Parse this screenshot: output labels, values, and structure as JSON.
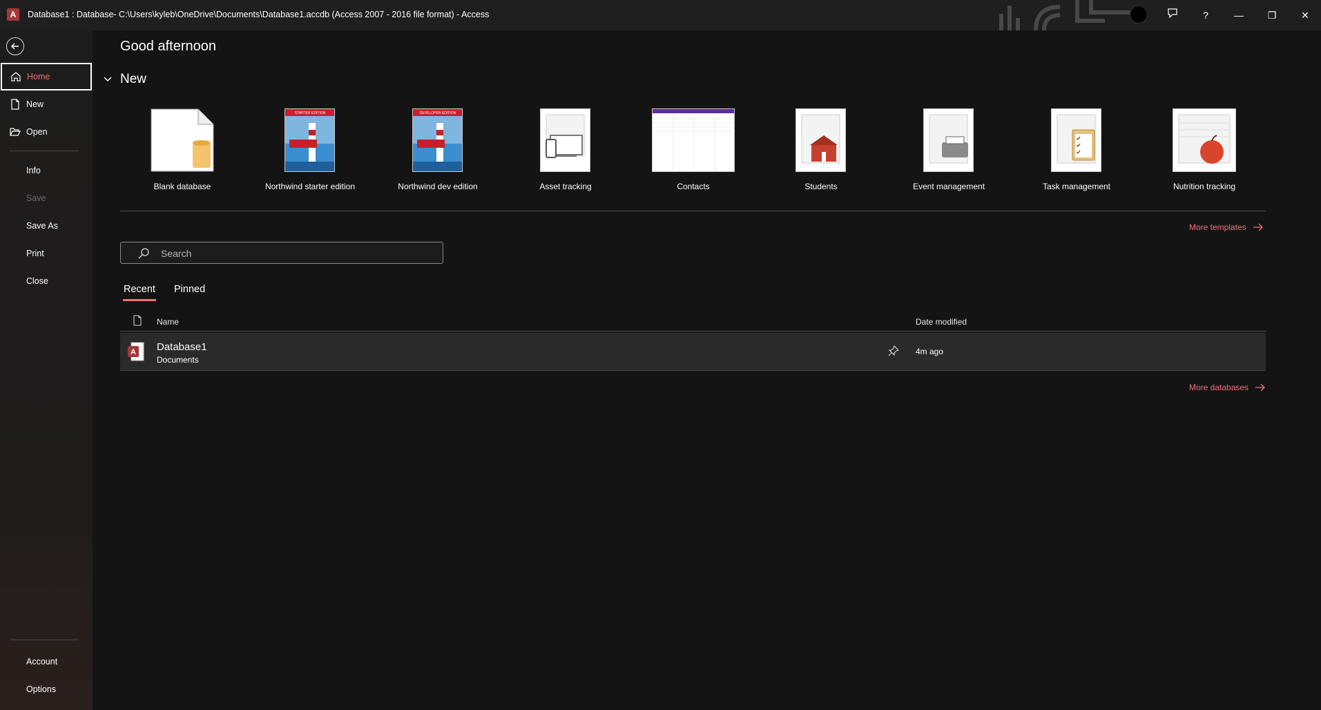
{
  "window": {
    "title": "Database1 : Database- C:\\Users\\kyleb\\OneDrive\\Documents\\Database1.accdb (Access 2007 - 2016 file format)  -  Access",
    "app_icon_letter": "A",
    "buttons": {
      "feedback": "feedback-icon",
      "help": "?",
      "minimize": "—",
      "restore": "❐",
      "close": "✕"
    }
  },
  "sidebar": {
    "items": [
      {
        "label": "Home",
        "icon": "home-icon"
      },
      {
        "label": "New",
        "icon": "new-document-icon"
      },
      {
        "label": "Open",
        "icon": "folder-open-icon"
      },
      {
        "label": "Info"
      },
      {
        "label": "Save"
      },
      {
        "label": "Save As"
      },
      {
        "label": "Print"
      },
      {
        "label": "Close"
      }
    ],
    "bottom": [
      {
        "label": "Account"
      },
      {
        "label": "Options"
      }
    ]
  },
  "main": {
    "greeting": "Good afternoon",
    "new_section": "New",
    "templates": [
      {
        "label": "Blank database"
      },
      {
        "label": "Northwind starter edition",
        "banner": "STARTER EDITION"
      },
      {
        "label": "Northwind dev edition",
        "banner": "DEVELOPER EDITION"
      },
      {
        "label": "Asset tracking"
      },
      {
        "label": "Contacts"
      },
      {
        "label": "Students"
      },
      {
        "label": "Event management"
      },
      {
        "label": "Task management"
      },
      {
        "label": "Nutrition tracking"
      }
    ],
    "more_templates": "More templates",
    "search_placeholder": "Search",
    "tabs": [
      {
        "label": "Recent"
      },
      {
        "label": "Pinned"
      }
    ],
    "table": {
      "headers": {
        "name": "Name",
        "date": "Date modified"
      },
      "rows": [
        {
          "name": "Database1",
          "location": "Documents",
          "date": "4m ago"
        }
      ]
    },
    "more_databases": "More databases"
  },
  "colors": {
    "accent": "#f1707b",
    "access_red": "#a4373a",
    "background": "#141414"
  }
}
